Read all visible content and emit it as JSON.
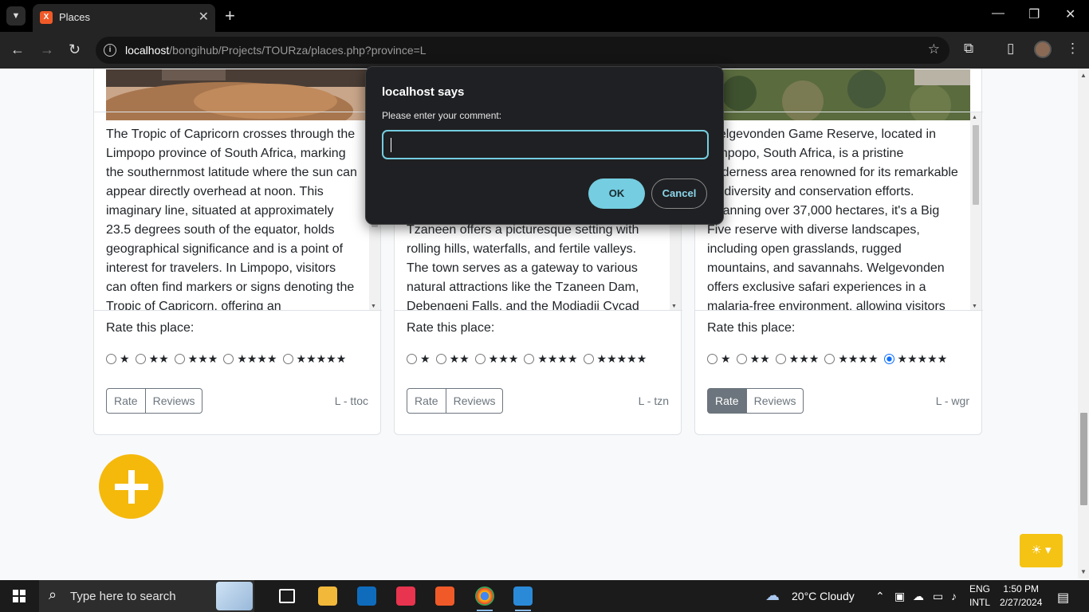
{
  "browser": {
    "tab_title": "Places",
    "url_host": "localhost",
    "url_path": "/bongihub/Projects/TOURza/places.php?province=L"
  },
  "cards": [
    {
      "description": "The Tropic of Capricorn crosses through the Limpopo province of South Africa, marking the southernmost latitude where the sun can appear directly overhead at noon. This imaginary line, situated at approximately 23.5 degrees south of the equator, holds geographical significance and is a point of interest for travelers. In Limpopo, visitors can often find markers or signs denoting the Tropic of Capricorn, offering an",
      "rate_label": "Rate this place:",
      "rating_options": [
        "★",
        "★★",
        "★★★",
        "★★★★",
        "★★★★★"
      ],
      "selected_rating": null,
      "rate_button": "Rate",
      "reviews_button": "Reviews",
      "code": "L - ttoc"
    },
    {
      "description": "prowess, particularly in citrus farming, Tzaneen offers a picturesque setting with rolling hills, waterfalls, and fertile valleys. The town serves as a gateway to various natural attractions like the Tzaneen Dam, Debengeni Falls, and the Modjadji Cycad",
      "rate_label": "Rate this place:",
      "rating_options": [
        "★",
        "★★",
        "★★★",
        "★★★★",
        "★★★★★"
      ],
      "selected_rating": null,
      "rate_button": "Rate",
      "reviews_button": "Reviews",
      "code": "L - tzn"
    },
    {
      "description": "Welgevonden Game Reserve, located in Limpopo, South Africa, is a pristine wilderness area renowned for its remarkable biodiversity and conservation efforts. Spanning over 37,000 hectares, it's a Big Five reserve with diverse landscapes, including open grasslands, rugged mountains, and savannahs. Welgevonden offers exclusive safari experiences in a malaria-free environment, allowing visitors",
      "rate_label": "Rate this place:",
      "rating_options": [
        "★",
        "★★",
        "★★★",
        "★★★★",
        "★★★★★"
      ],
      "selected_rating": 5,
      "rate_button": "Rate",
      "reviews_button": "Reviews",
      "code": "L - wgr"
    }
  ],
  "dialog": {
    "title": "localhost says",
    "message": "Please enter your comment:",
    "input_value": "",
    "ok_label": "OK",
    "cancel_label": "Cancel"
  },
  "taskbar": {
    "search_placeholder": "Type here to search",
    "weather": "20°C  Cloudy",
    "language_line1": "ENG",
    "language_line2": "INTL",
    "time": "1:50 PM",
    "date": "2/27/2024"
  },
  "colors": {
    "fab": "#f5b90c",
    "dialog_accent": "#74cde0",
    "theme_toggle": "#f5c313"
  }
}
